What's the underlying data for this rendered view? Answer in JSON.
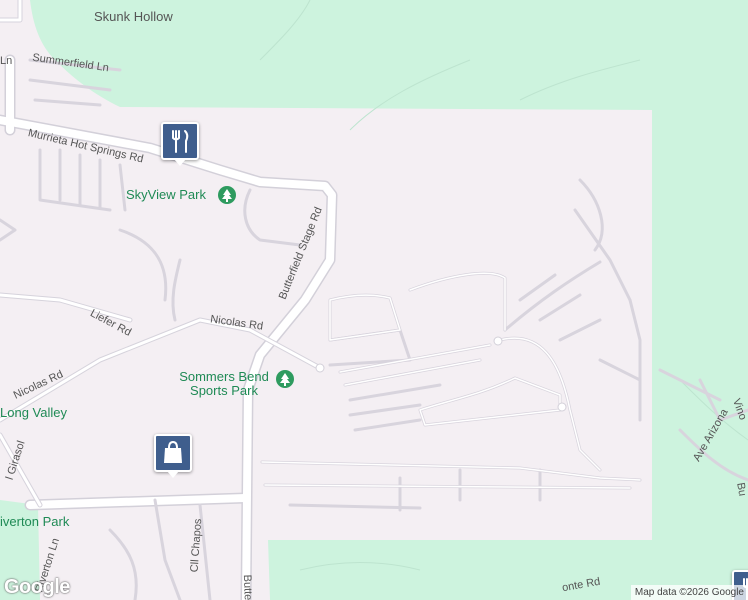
{
  "map": {
    "colors": {
      "background": "#f4eff3",
      "green_area": "#cdf3de",
      "road": "#ffffff",
      "road_edge": "#d6d3dc",
      "park": "#2e9b5f",
      "marker": "#3f5e8d"
    },
    "labels": {
      "skunk_hollow": "Skunk Hollow",
      "summerfield": "Summerfield Ln",
      "murrieta": "Murrieta Hot Springs Rd",
      "skyview_park": "SkyView Park",
      "butterfield_1": "Butterfield Stage Rd",
      "liefer": "Liefer Rd",
      "nicolas_1": "Nicolas Rd",
      "nicolas_2": "Nicolas Rd",
      "sommers_park": "Sommers Bend Sports Park",
      "long_valley": "Long Valley",
      "girasol": "l Girasol",
      "riverton_park": "iverton Park",
      "riverton_ln": "Riverton Ln",
      "cll_chapos": "Cll Chapos",
      "butterfield_2": "Butte",
      "ave_arizona": "Ave Arizona",
      "vino": "Vino",
      "bu": "Bu",
      "monte": "onte Rd",
      "ln_fragment": "Ln"
    },
    "icons": {
      "restaurant": "restaurant-icon",
      "shopping": "shopping-bag-icon",
      "park": "park-tree-icon"
    },
    "attribution": "Map data ©2026 Google",
    "logo": "Google"
  }
}
